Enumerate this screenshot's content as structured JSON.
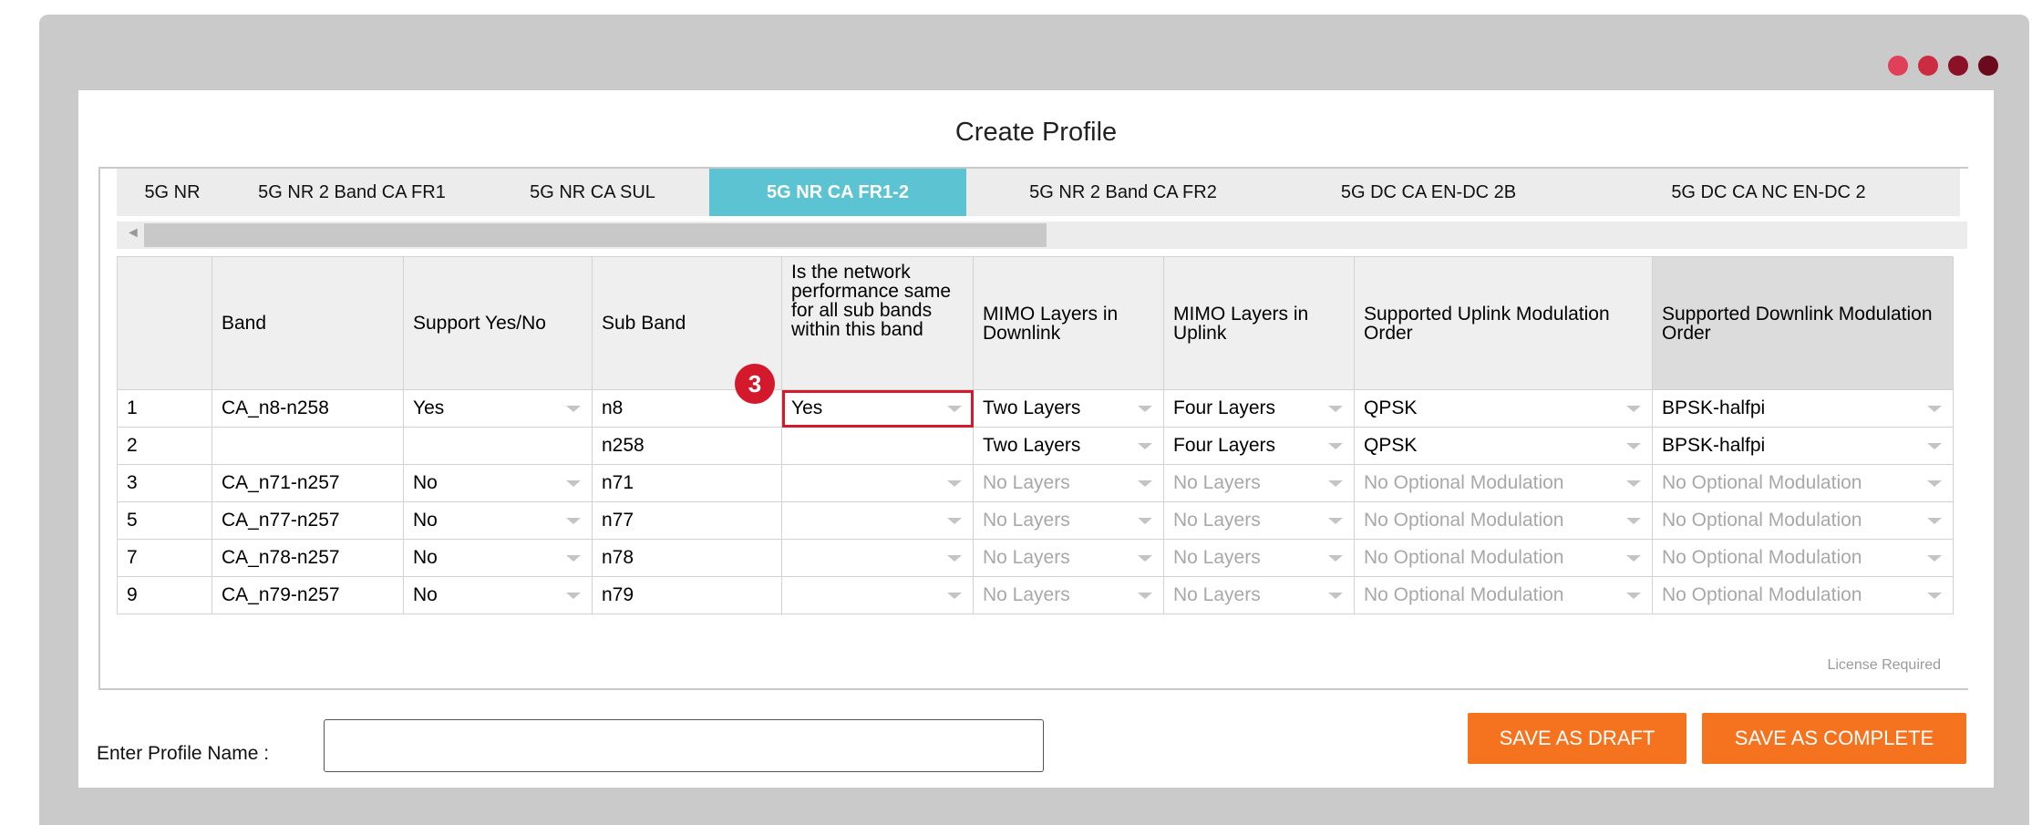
{
  "window": {
    "dots": [
      "#e0405a",
      "#cc2c42",
      "#8c1026",
      "#6a0a1c"
    ]
  },
  "dialog": {
    "title": "Create Profile"
  },
  "tabs": [
    {
      "label": "5G NR",
      "active": false
    },
    {
      "label": "5G NR 2 Band CA FR1",
      "active": false
    },
    {
      "label": "5G NR CA SUL",
      "active": false
    },
    {
      "label": "5G NR CA FR1-2",
      "active": true
    },
    {
      "label": "5G NR 2 Band CA FR2",
      "active": false
    },
    {
      "label": "5G DC CA EN-DC 2B",
      "active": false
    },
    {
      "label": "5G DC CA NC EN-DC 2",
      "active": false
    }
  ],
  "table": {
    "columns": [
      "",
      "Band",
      "Support Yes/No",
      "Sub Band",
      "Is the network performance same for all sub bands within this band",
      "MIMO Layers in Downlink",
      "MIMO Layers in Uplink",
      "Supported Uplink Modulation Order",
      "Supported Downlink Modulation Order"
    ],
    "rows": [
      {
        "n": "1",
        "band": "CA_n8-n258",
        "support": "Yes",
        "sub_band": "n8",
        "same_perf": "Yes",
        "mimo_dl": "Two Layers",
        "mimo_ul": "Four Layers",
        "ul_mod": "QPSK",
        "dl_mod": "BPSK-halfpi"
      },
      {
        "n": "2",
        "band": "",
        "support": "",
        "sub_band": "n258",
        "same_perf": "",
        "mimo_dl": "Two Layers",
        "mimo_ul": "Four Layers",
        "ul_mod": "QPSK",
        "dl_mod": "BPSK-halfpi"
      },
      {
        "n": "3",
        "band": "CA_n71-n257",
        "support": "No",
        "sub_band": "n71",
        "same_perf": "",
        "mimo_dl": "No Layers",
        "mimo_ul": "No Layers",
        "ul_mod": "No Optional Modulation",
        "dl_mod": "No Optional Modulation"
      },
      {
        "n": "5",
        "band": "CA_n77-n257",
        "support": "No",
        "sub_band": "n77",
        "same_perf": "",
        "mimo_dl": "No Layers",
        "mimo_ul": "No Layers",
        "ul_mod": "No Optional Modulation",
        "dl_mod": "No Optional Modulation"
      },
      {
        "n": "7",
        "band": "CA_n78-n257",
        "support": "No",
        "sub_band": "n78",
        "same_perf": "",
        "mimo_dl": "No Layers",
        "mimo_ul": "No Layers",
        "ul_mod": "No Optional Modulation",
        "dl_mod": "No Optional Modulation"
      },
      {
        "n": "9",
        "band": "CA_n79-n257",
        "support": "No",
        "sub_band": "n79",
        "same_perf": "",
        "mimo_dl": "No Layers",
        "mimo_ul": "No Layers",
        "ul_mod": "No Optional Modulation",
        "dl_mod": "No Optional Modulation"
      }
    ]
  },
  "callout": {
    "number": "3"
  },
  "license_note": "License Required",
  "profile": {
    "label": "Enter Profile Name :",
    "value": ""
  },
  "buttons": {
    "save_draft": "SAVE AS DRAFT",
    "save_complete": "SAVE AS COMPLETE"
  }
}
